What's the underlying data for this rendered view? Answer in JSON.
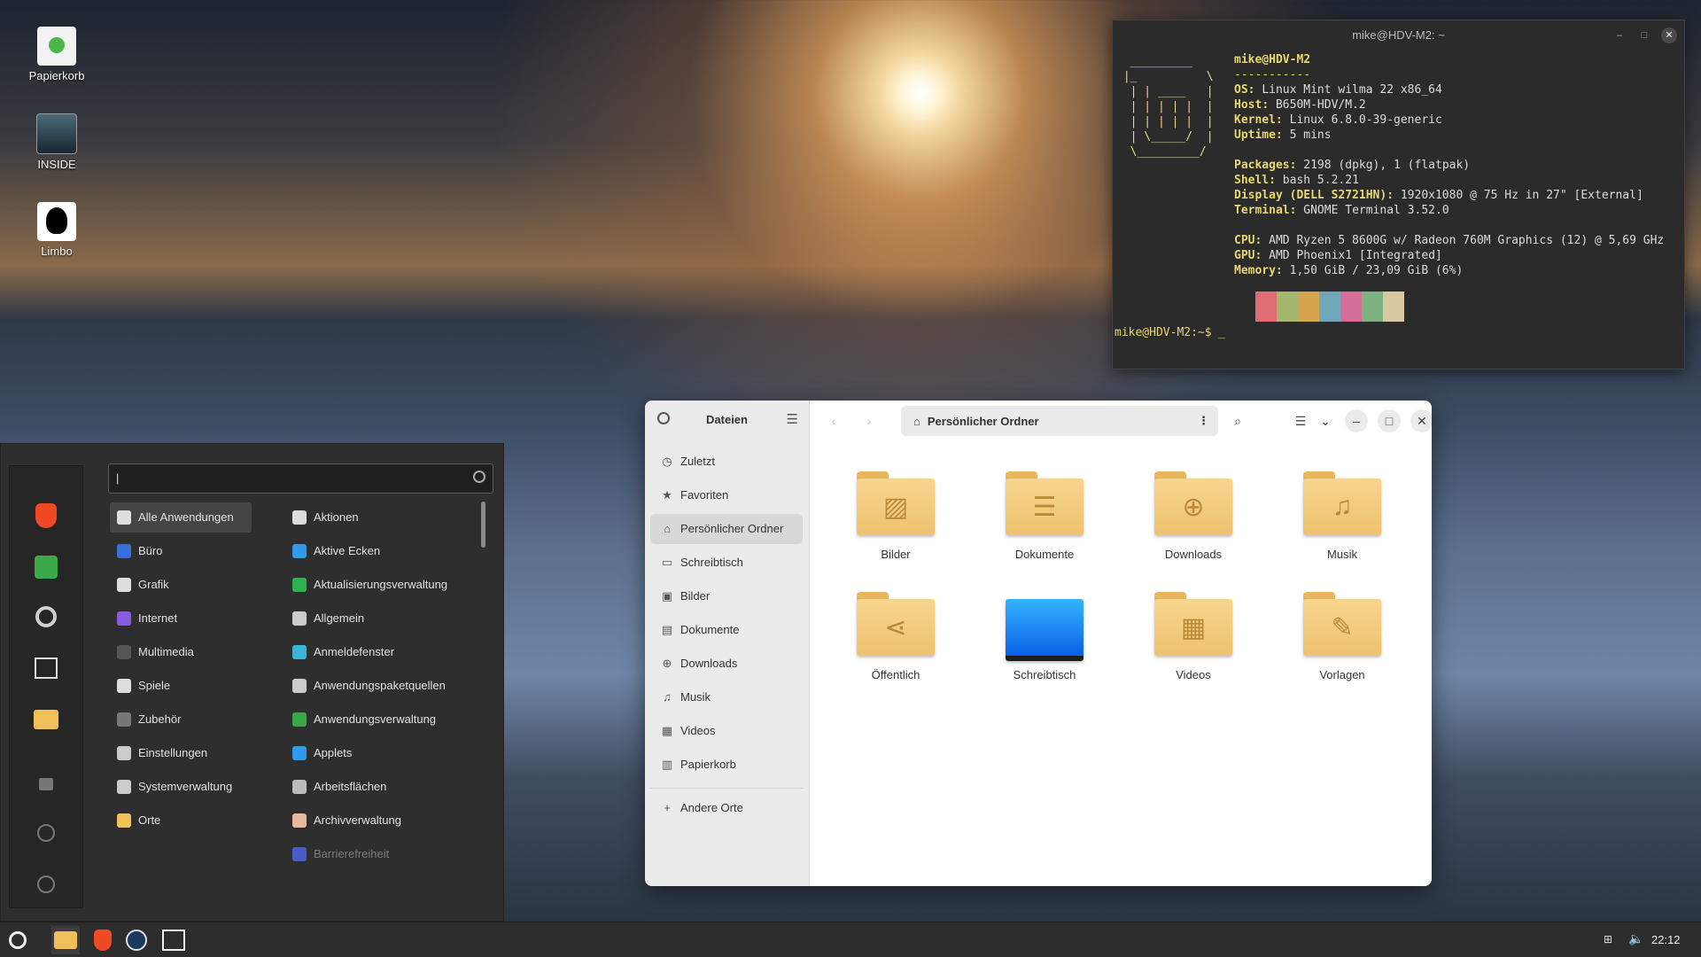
{
  "desktop": {
    "icons": [
      {
        "label": "Papierkorb",
        "icon": "trash-icon"
      },
      {
        "label": "INSIDE",
        "icon": "game-inside-icon"
      },
      {
        "label": "Limbo",
        "icon": "game-limbo-icon"
      }
    ]
  },
  "terminal": {
    "title": "mike@HDV-M2: ~",
    "host": "mike@HDV-M2",
    "separator": "-----------",
    "info": [
      {
        "key": "OS",
        "value": "Linux Mint wilma 22 x86_64"
      },
      {
        "key": "Host",
        "value": "B650M-HDV/M.2"
      },
      {
        "key": "Kernel",
        "value": "Linux 6.8.0-39-generic"
      },
      {
        "key": "Uptime",
        "value": "5 mins"
      },
      {
        "key": "Packages",
        "value": "2198 (dpkg), 1 (flatpak)"
      },
      {
        "key": "Shell",
        "value": "bash 5.2.21"
      },
      {
        "key": "Display (DELL S2721HN)",
        "value": "1920x1080 @ 75 Hz in 27\" [External]"
      },
      {
        "key": "Terminal",
        "value": "GNOME Terminal 3.52.0"
      },
      {
        "key": "CPU",
        "value": "AMD Ryzen 5 8600G w/ Radeon 760M Graphics (12) @ 5,69 GHz"
      },
      {
        "key": "GPU",
        "value": "AMD Phoenix1 [Integrated]"
      },
      {
        "key": "Memory",
        "value": "1,50 GiB / 23,09 GiB (6%)"
      }
    ],
    "palette": [
      "#2b2b2b",
      "#e06c75",
      "#a3b86c",
      "#d6a34e",
      "#6fa8b8",
      "#d46f9a",
      "#7fb07f",
      "#d9c7a0"
    ],
    "prompt": "mike@HDV-M2:~$ _"
  },
  "menu": {
    "search_value": "|",
    "categories": [
      {
        "label": "Alle Anwendungen",
        "icon": "grid-icon",
        "selected": true
      },
      {
        "label": "Büro",
        "icon": "office-icon"
      },
      {
        "label": "Grafik",
        "icon": "graphics-icon"
      },
      {
        "label": "Internet",
        "icon": "internet-icon"
      },
      {
        "label": "Multimedia",
        "icon": "multimedia-icon"
      },
      {
        "label": "Spiele",
        "icon": "gamepad-icon"
      },
      {
        "label": "Zubehör",
        "icon": "accessories-icon"
      },
      {
        "label": "Einstellungen",
        "icon": "gear-icon"
      },
      {
        "label": "Systemverwaltung",
        "icon": "gear-icon"
      },
      {
        "label": "Orte",
        "icon": "folder-icon"
      }
    ],
    "apps": [
      {
        "label": "Aktionen",
        "icon": "actions-icon"
      },
      {
        "label": "Aktive Ecken",
        "icon": "hot-corners-icon"
      },
      {
        "label": "Aktualisierungsverwaltung",
        "icon": "update-icon"
      },
      {
        "label": "Allgemein",
        "icon": "gear-icon"
      },
      {
        "label": "Anmeldefenster",
        "icon": "login-icon"
      },
      {
        "label": "Anwendungspaketquellen",
        "icon": "gear-icon"
      },
      {
        "label": "Anwendungsverwaltung",
        "icon": "software-icon"
      },
      {
        "label": "Applets",
        "icon": "applets-icon"
      },
      {
        "label": "Arbeitsflächen",
        "icon": "workspaces-icon"
      },
      {
        "label": "Archivverwaltung",
        "icon": "archive-icon"
      },
      {
        "label": "Barrierefreiheit",
        "icon": "accessibility-icon",
        "dim": true
      }
    ]
  },
  "files": {
    "app_title": "Dateien",
    "path": "Persönlicher Ordner",
    "sidebar": [
      {
        "label": "Zuletzt",
        "icon": "clock-icon"
      },
      {
        "label": "Favoriten",
        "icon": "star-icon"
      },
      {
        "label": "Persönlicher Ordner",
        "icon": "home-icon",
        "selected": true
      },
      {
        "label": "Schreibtisch",
        "icon": "desktop-icon"
      },
      {
        "label": "Bilder",
        "icon": "image-icon"
      },
      {
        "label": "Dokumente",
        "icon": "document-icon"
      },
      {
        "label": "Downloads",
        "icon": "download-icon"
      },
      {
        "label": "Musik",
        "icon": "music-icon"
      },
      {
        "label": "Videos",
        "icon": "video-icon"
      },
      {
        "label": "Papierkorb",
        "icon": "trash-icon"
      }
    ],
    "other_places": "Andere Orte",
    "folders": [
      {
        "label": "Bilder",
        "icon": "image-icon"
      },
      {
        "label": "Dokumente",
        "icon": "document-icon"
      },
      {
        "label": "Downloads",
        "icon": "download-icon"
      },
      {
        "label": "Musik",
        "icon": "music-icon"
      },
      {
        "label": "Öffentlich",
        "icon": "share-icon"
      },
      {
        "label": "Schreibtisch",
        "icon": "desktop-icon"
      },
      {
        "label": "Videos",
        "icon": "video-icon"
      },
      {
        "label": "Vorlagen",
        "icon": "template-icon"
      }
    ]
  },
  "taskbar": {
    "clock": "22:12"
  }
}
